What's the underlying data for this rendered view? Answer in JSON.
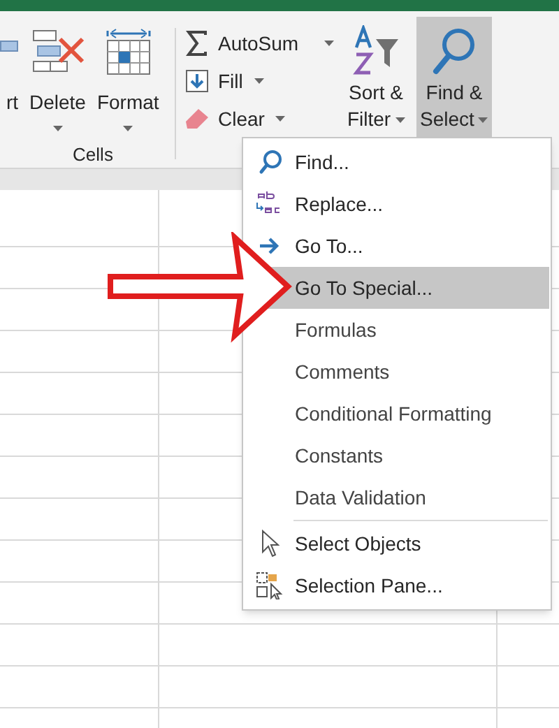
{
  "ribbon": {
    "cells_group": {
      "label": "Cells",
      "buttons": [
        {
          "kind": "insert",
          "label": "rt"
        },
        {
          "kind": "delete",
          "label": "Delete",
          "dropdown": true
        },
        {
          "kind": "format",
          "label": "Format",
          "dropdown": true
        }
      ]
    },
    "editing_group": {
      "small_buttons": [
        {
          "kind": "sum",
          "label": "AutoSum",
          "dropdown": true
        },
        {
          "kind": "fill",
          "label": "Fill",
          "dropdown": true
        },
        {
          "kind": "clear",
          "label": "Clear",
          "dropdown": true
        }
      ],
      "large_buttons": [
        {
          "kind": "sort",
          "label": "Sort &",
          "label_2": "Filter",
          "pressed": false
        },
        {
          "kind": "find",
          "label": "Find &",
          "label_2": "Select",
          "pressed": true
        }
      ]
    }
  },
  "menu": {
    "sections": [
      [
        {
          "kind": "find",
          "label": "Find...",
          "selected": false
        },
        {
          "kind": "replace",
          "label": "Replace...",
          "selected": false
        },
        {
          "kind": "goto",
          "label": "Go To...",
          "selected": false
        },
        {
          "kind": "plain",
          "label": "Go To Special...",
          "selected": true
        },
        {
          "kind": "plain",
          "label": "Formulas",
          "selected": false
        },
        {
          "kind": "plain",
          "label": "Comments",
          "selected": false
        },
        {
          "kind": "plain",
          "label": "Conditional Formatting",
          "selected": false
        },
        {
          "kind": "plain",
          "label": "Constants",
          "selected": false
        },
        {
          "kind": "plain",
          "label": "Data Validation",
          "selected": false
        }
      ],
      [
        {
          "kind": "pointer",
          "label": "Select Objects",
          "selected": false
        },
        {
          "kind": "pane",
          "label": "Selection Pane...",
          "selected": false
        }
      ]
    ]
  }
}
